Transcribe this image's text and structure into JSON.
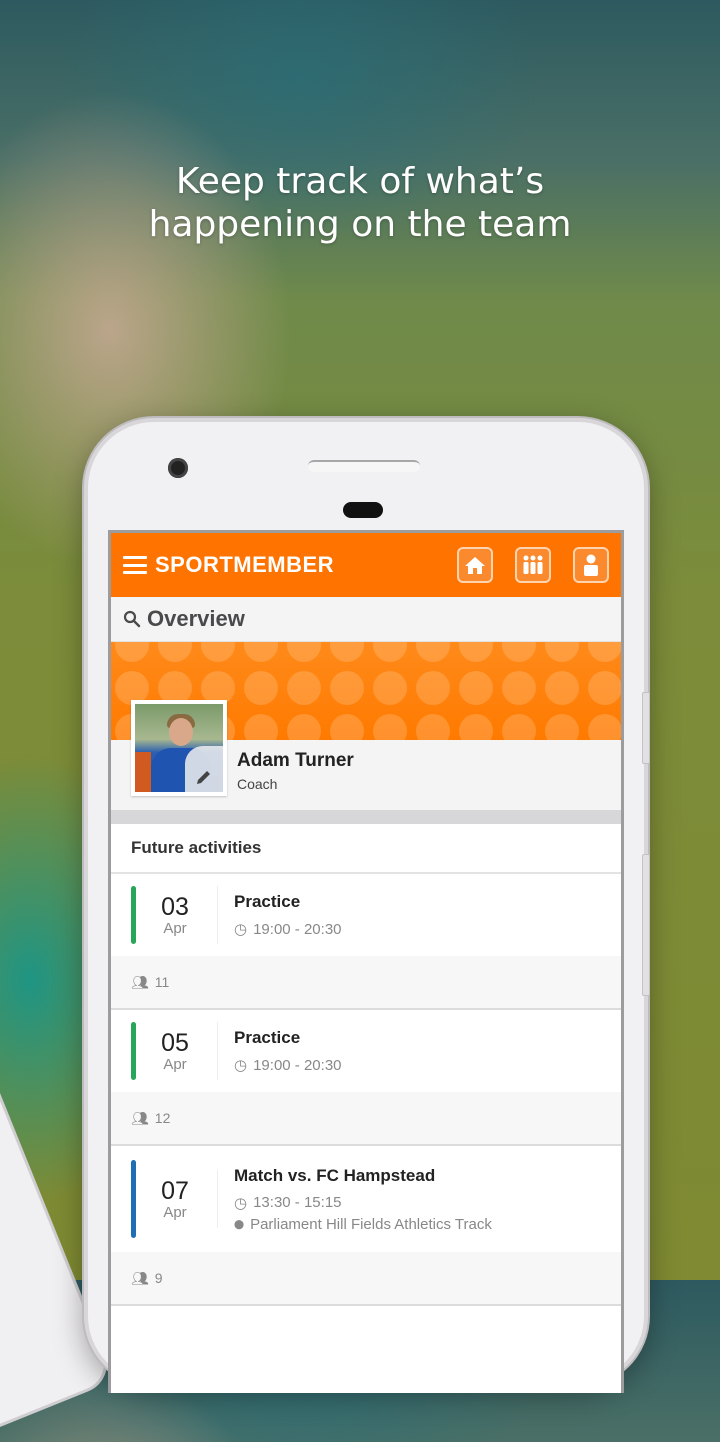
{
  "tagline": {
    "line1": "Keep track of what’s",
    "line2": "happening on the team"
  },
  "app": {
    "logo": "SPORTMEMBER",
    "brand_color": "#ff7300",
    "icons": [
      "menu-icon",
      "home-icon",
      "team-icon",
      "profile-icon"
    ]
  },
  "subbar": {
    "title": "Overview",
    "icon": "search-icon"
  },
  "profile": {
    "name": "Adam Turner",
    "role": "Coach",
    "edit_icon": "pencil-icon"
  },
  "section": {
    "title": "Future activities"
  },
  "activities": [
    {
      "day": "03",
      "month": "Apr",
      "title": "Practice",
      "time": "19:00 - 20:30",
      "location": null,
      "attendees": "11",
      "color": "#27a65a"
    },
    {
      "day": "05",
      "month": "Apr",
      "title": "Practice",
      "time": "19:00 - 20:30",
      "location": null,
      "attendees": "12",
      "color": "#27a65a"
    },
    {
      "day": "07",
      "month": "Apr",
      "title": "Match vs. FC Hampstead",
      "time": "13:30 - 15:15",
      "location": "Parliament Hill Fields Athletics Track",
      "attendees": "9",
      "color": "#1f6fb5"
    }
  ]
}
